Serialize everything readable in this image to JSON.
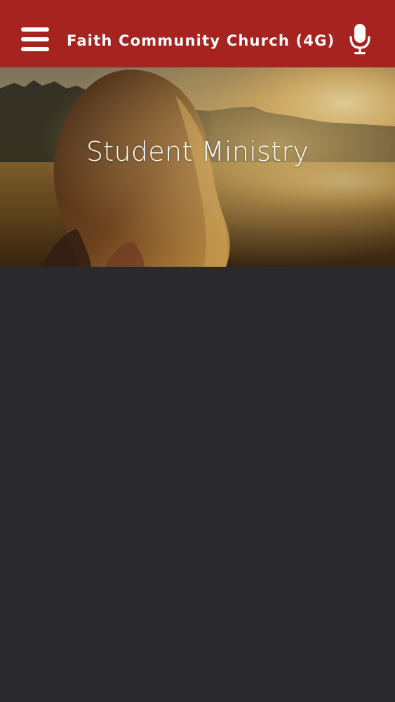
{
  "header": {
    "title": "Faith Community Church (4G)",
    "menu_icon": "hamburger-menu-icon",
    "mic_icon": "microphone-icon",
    "background_color": "#a7231f"
  },
  "hero": {
    "title": "Student Ministry",
    "image": "girl-in-sunset-field-photo"
  },
  "content": {
    "background_color": "#2a292b"
  }
}
